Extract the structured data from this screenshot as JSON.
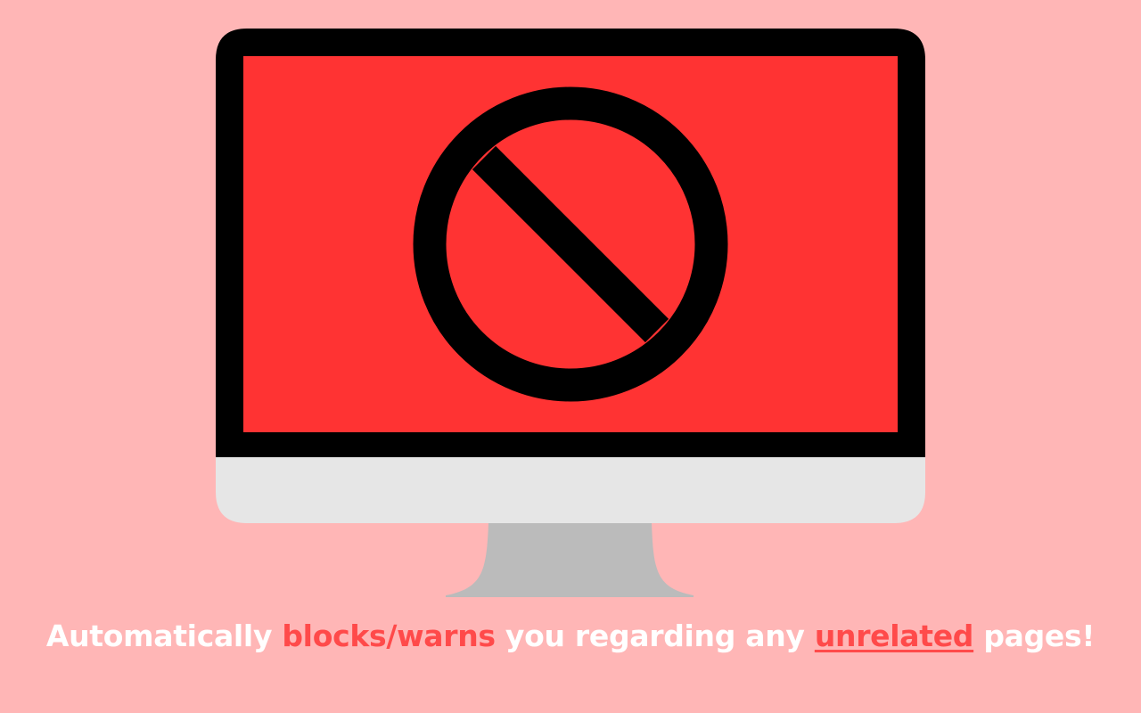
{
  "illustration": {
    "subject": "desktop monitor displaying a prohibition sign",
    "icon": "prohibited-icon",
    "colors": {
      "background": "#ffb6b6",
      "screen": "#ff3333",
      "bezel": "#000000",
      "chin": "#e6e6e6",
      "stand": "#bbbbbb",
      "sign": "#000000"
    }
  },
  "tagline": {
    "part1": "Automatically ",
    "highlight1": "blocks/warns",
    "part2": " you regarding any ",
    "highlight2": "unrelated",
    "part3": " pages!",
    "colors": {
      "text": "#ffffff",
      "accent": "#ff4a4a"
    }
  }
}
